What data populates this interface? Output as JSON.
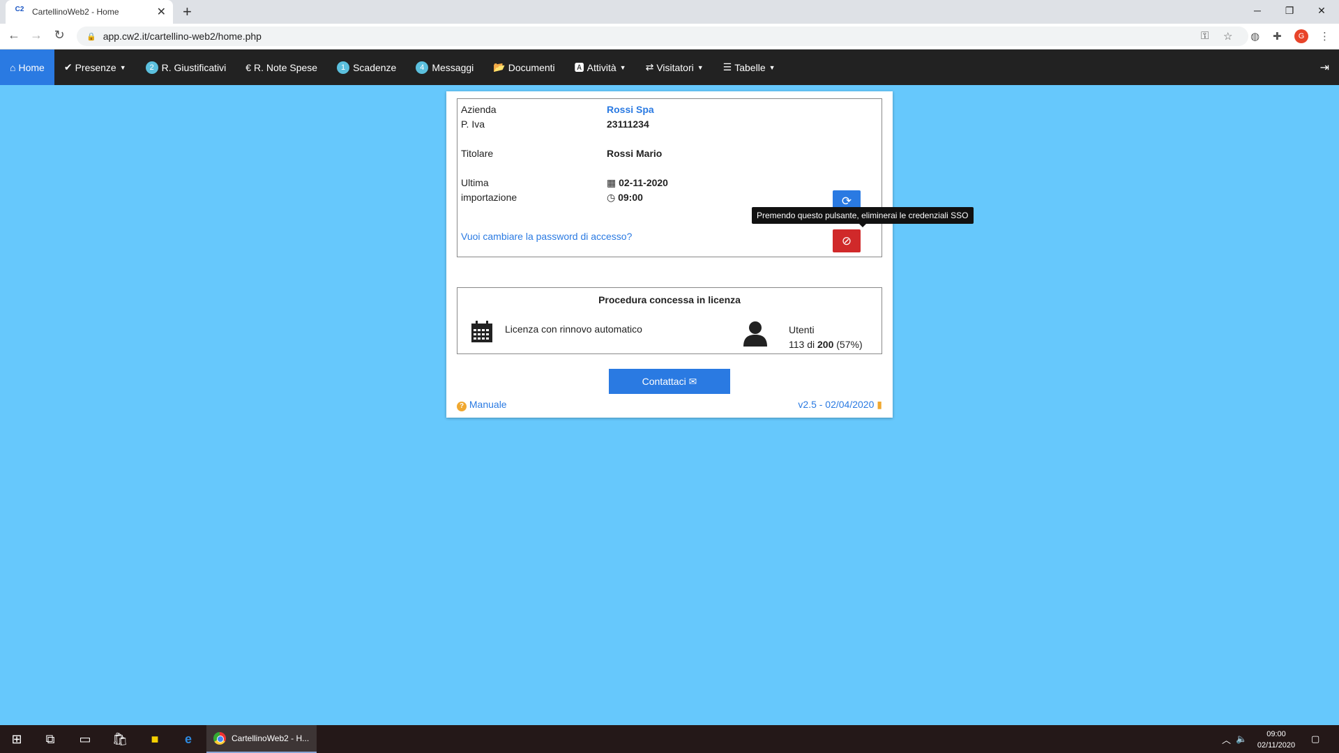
{
  "browser": {
    "tab_title": "CartellinoWeb2 - Home",
    "favicon_text": "C2",
    "url": "app.cw2.it/cartellino-web2/home.php",
    "profile_initial": "G"
  },
  "nav": {
    "home": "Home",
    "presenze": "Presenze",
    "giustificativi_badge": "2",
    "giustificativi": "R. Giustificativi",
    "note_spese": "R. Note Spese",
    "scadenze_badge": "1",
    "scadenze": "Scadenze",
    "messaggi_badge": "4",
    "messaggi": "Messaggi",
    "documenti": "Documenti",
    "attivita": "Attività",
    "visitatori": "Visitatori",
    "tabelle": "Tabelle"
  },
  "info": {
    "azienda_label": "Azienda",
    "azienda_value": "Rossi Spa",
    "piva_label": "P. Iva",
    "piva_value": "23111234",
    "titolare_label": "Titolare",
    "titolare_value": "Rossi Mario",
    "ultima_label_1": "Ultima",
    "ultima_label_2": "importazione",
    "import_date": "02-11-2020",
    "import_time": "09:00",
    "password_link": "Vuoi cambiare la password di accesso?"
  },
  "tooltip": "Premendo questo pulsante, eliminerai le credenziali SSO",
  "license": {
    "title": "Procedura concessa in licenza",
    "type": "Licenza con rinnovo automatico",
    "users_label": "Utenti",
    "users_used": "113",
    "users_of": "di",
    "users_total": "200",
    "users_pct": "(57%)"
  },
  "contact_button": "Contattaci",
  "manual_link": "Manuale",
  "version": "v2.5 - 02/04/2020",
  "taskbar": {
    "task_label": "CartellinoWeb2 - H...",
    "time": "09:00",
    "date": "02/11/2020"
  }
}
